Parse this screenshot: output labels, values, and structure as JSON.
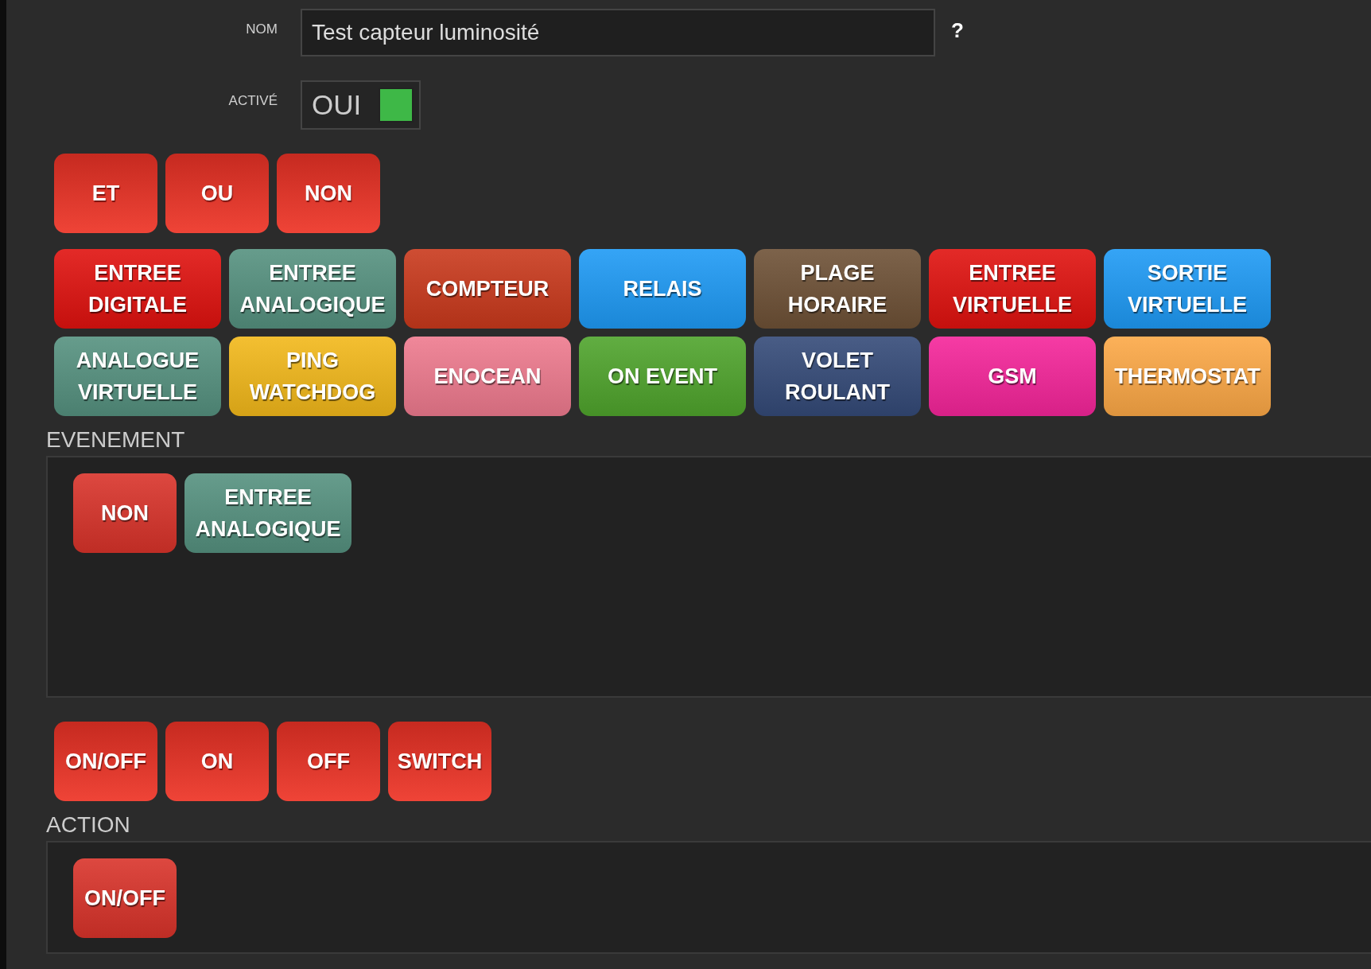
{
  "form": {
    "name_label": "NOM",
    "name_value": "Test capteur luminosité",
    "help": "?",
    "active_label": "ACTIVÉ",
    "active_text": "OUI",
    "active_checked": true
  },
  "logic_buttons": [
    {
      "label": "ET"
    },
    {
      "label": "OU"
    },
    {
      "label": "NON"
    }
  ],
  "blocks": [
    {
      "label": "ENTREE DIGITALE",
      "color": "#e0120f"
    },
    {
      "label": "ENTREE ANALOGIQUE",
      "color": "#55917f"
    },
    {
      "label": "COMPTEUR",
      "color": "#c9391c"
    },
    {
      "label": "RELAIS",
      "color": "#1e9af5"
    },
    {
      "label": "PLAGE HORAIRE",
      "color": "#6e5136"
    },
    {
      "label": "ENTREE VIRTUELLE",
      "color": "#e0120f"
    },
    {
      "label": "SORTIE VIRTUELLE",
      "color": "#1e9af5"
    },
    {
      "label": "ANALOGUE VIRTUELLE",
      "color": "#55917f"
    },
    {
      "label": "PING WATCHDOG",
      "color": "#f2b81a"
    },
    {
      "label": "ENOCEAN",
      "color": "#ee7a8e"
    },
    {
      "label": "ON EVENT",
      "color": "#4fa42c"
    },
    {
      "label": "VOLET ROULANT",
      "color": "#344a78"
    },
    {
      "label": "GSM",
      "color": "#f5259a"
    },
    {
      "label": "THERMOSTAT",
      "color": "#fca846"
    }
  ],
  "event": {
    "title": "EVENEMENT",
    "items": [
      {
        "label": "NON",
        "color": "#d9332a"
      },
      {
        "label": "ENTREE ANALOGIQUE",
        "color": "#55917f"
      }
    ]
  },
  "action_buttons": [
    {
      "label": "ON/OFF"
    },
    {
      "label": "ON"
    },
    {
      "label": "OFF"
    },
    {
      "label": "SWITCH"
    }
  ],
  "action": {
    "title": "ACTION",
    "items": [
      {
        "label": "ON/OFF",
        "color": "#d9332a"
      }
    ]
  }
}
